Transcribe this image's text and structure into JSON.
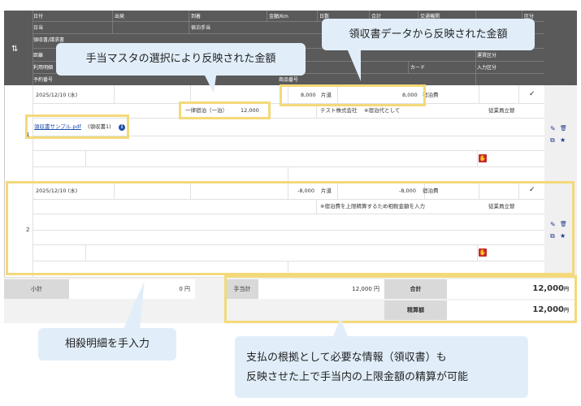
{
  "header": {
    "row1": [
      "日付",
      "出発",
      "到着",
      "金額/Km",
      "日数",
      "合計",
      "交通機関",
      "区分"
    ],
    "row2_left": "日当",
    "row2_mid": "宿泊手当",
    "row3": "領収書/請求書",
    "row4": "距離",
    "row4_right": "運賃区分",
    "row5": "利用明細",
    "row5_right": "入力区分",
    "row5_card": "カード",
    "row6": "予約番号",
    "row6_mid": "商品番号"
  },
  "rows": [
    {
      "num": "1",
      "date": "2025/12/10 (水)",
      "amount": "8,000",
      "trip": "片道",
      "total": "8,000",
      "category": "宿泊費",
      "allowance_name": "一律宿泊（一泊）",
      "allowance_amount": "12,000",
      "vendor": "テスト株式会社",
      "memo": "※宿泊代として",
      "payer": "従業員立替",
      "receipt_link": "領収書サンプル.pdf",
      "receipt_tag": "(領収書1)",
      "info_glyph": "i"
    },
    {
      "num": "2",
      "date": "2025/12/10 (水)",
      "amount": "-8,000",
      "trip": "片道",
      "total": "-8,000",
      "category": "宿泊費",
      "memo": "※宿泊費を上限精算するため相殺金額を入力",
      "payer": "従業員立替"
    }
  ],
  "summary": {
    "subtotal_label": "小計",
    "subtotal_value": "0 円",
    "allowance_label": "手当計",
    "allowance_value": "12,000 円",
    "total_label": "合計",
    "total_value": "12,000",
    "total_unit": "円",
    "settle_label": "精算額",
    "settle_value": "12,000",
    "settle_unit": "円"
  },
  "callouts": {
    "allowance_master": "手当マスタの選択により反映された金額",
    "receipt_data": "領収書データから反映された金額",
    "offset_manual": "相殺明細を手入力",
    "basis_line1": "支払の根拠として必要な情報（領収書）も",
    "basis_line2": "反映させた上で手当内の上限金額の精算が可能"
  },
  "icons": {
    "sort": "sort-arrows-icon",
    "edit": "pencil-icon",
    "delete": "trash-icon",
    "copy": "copy-icon",
    "favorite": "star-icon",
    "hand": "stop-hand-icon",
    "check": "check-icon",
    "info": "info-icon"
  },
  "colors": {
    "header_bg": "#5a5a5a",
    "highlight": "#f3d97a",
    "callout_bg": "#e1eefa",
    "link": "#1f4fa8",
    "icon": "#1f3a8a",
    "hand": "#c62828"
  },
  "glyphs": {
    "sort": "⇅",
    "check": "✓",
    "edit": "✎",
    "delete": "🗑",
    "copy": "⧉",
    "star": "★",
    "hand": "✋"
  }
}
